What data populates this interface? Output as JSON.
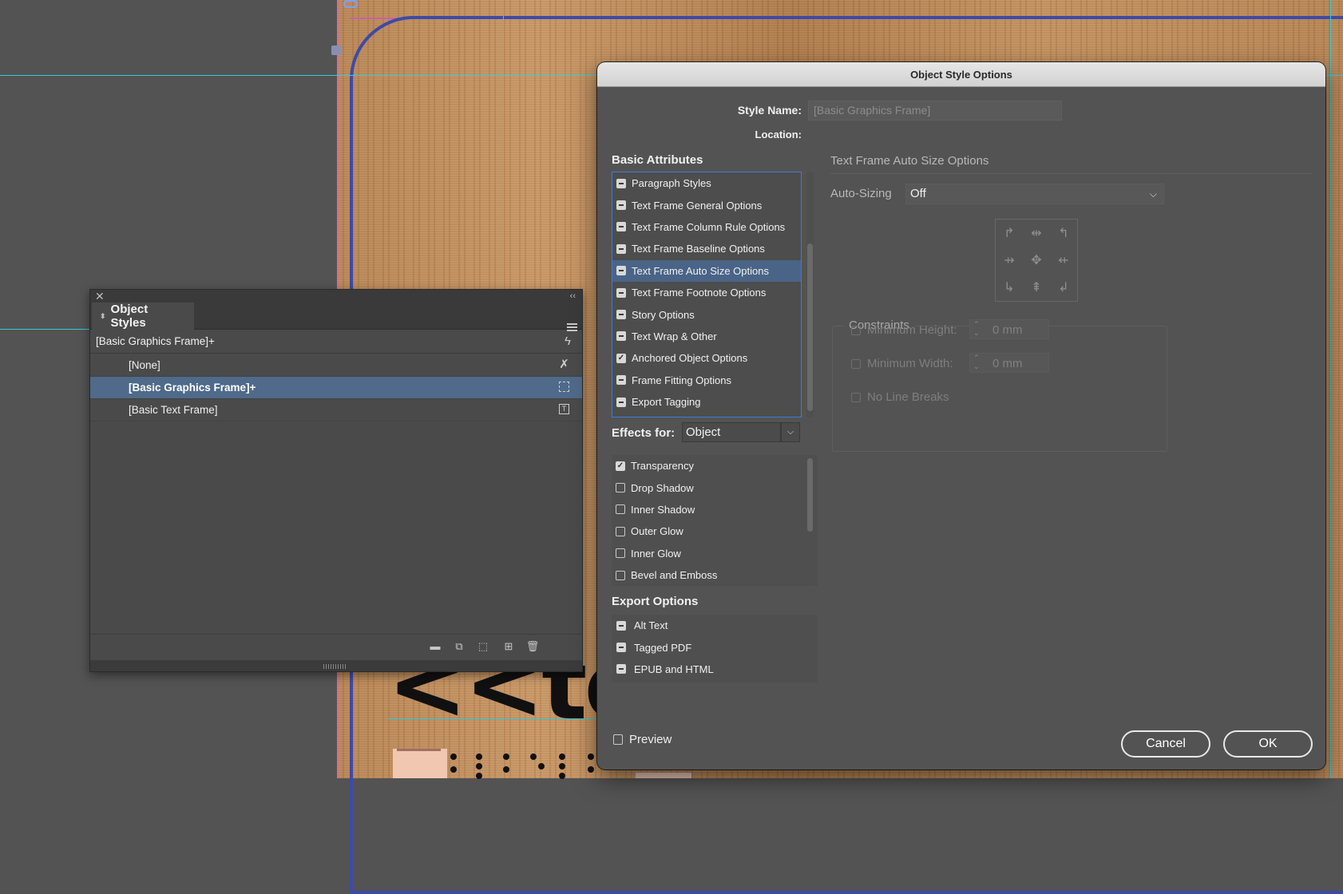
{
  "object_styles_panel": {
    "tab_label": "Object Styles",
    "current_style": "[Basic Graphics Frame]+",
    "styles": [
      {
        "label": "[None]",
        "icon": "none-style-icon"
      },
      {
        "label": "[Basic Graphics Frame]+",
        "icon": "graphics-frame-icon"
      },
      {
        "label": "[Basic Text Frame]",
        "icon": "text-frame-icon"
      }
    ],
    "footer_icons": [
      "new-group-icon",
      "clear-overrides-icon",
      "clear-attributes-icon",
      "new-style-icon",
      "delete-icon"
    ]
  },
  "dialog": {
    "title": "Object Style Options",
    "style_name_label": "Style Name:",
    "style_name_value": "[Basic Graphics Frame]",
    "location_label": "Location:",
    "basic_attributes_title": "Basic Attributes",
    "basic_attributes": [
      {
        "label": "Paragraph Styles",
        "state": "dash"
      },
      {
        "label": "Text Frame General Options",
        "state": "dash"
      },
      {
        "label": "Text Frame Column Rule Options",
        "state": "dash"
      },
      {
        "label": "Text Frame Baseline Options",
        "state": "dash"
      },
      {
        "label": "Text Frame Auto Size Options",
        "state": "dash",
        "selected": true
      },
      {
        "label": "Text Frame Footnote Options",
        "state": "dash"
      },
      {
        "label": "Story Options",
        "state": "dash"
      },
      {
        "label": "Text Wrap & Other",
        "state": "dash"
      },
      {
        "label": "Anchored Object Options",
        "state": "checked"
      },
      {
        "label": "Frame Fitting Options",
        "state": "dash"
      },
      {
        "label": "Export Tagging",
        "state": "dash"
      }
    ],
    "effects_for_label": "Effects for:",
    "effects_for_value": "Object",
    "effects": [
      {
        "label": "Transparency",
        "state": "checked"
      },
      {
        "label": "Drop Shadow",
        "state": "empty"
      },
      {
        "label": "Inner Shadow",
        "state": "empty"
      },
      {
        "label": "Outer Glow",
        "state": "empty"
      },
      {
        "label": "Inner Glow",
        "state": "empty"
      },
      {
        "label": "Bevel and Emboss",
        "state": "empty"
      }
    ],
    "export_options_title": "Export Options",
    "export_options": [
      {
        "label": "Alt Text",
        "state": "dash"
      },
      {
        "label": "Tagged PDF",
        "state": "dash"
      },
      {
        "label": "EPUB and HTML",
        "state": "dash"
      }
    ],
    "section_title": "Text Frame Auto Size Options",
    "auto_sizing_label": "Auto-Sizing",
    "auto_sizing_value": "Off",
    "reference_point_icons": [
      "arrow-top-left-icon",
      "arrow-top-center-icon",
      "arrow-top-right-icon",
      "arrow-middle-left-icon",
      "arrow-center-icon",
      "arrow-middle-right-icon",
      "arrow-bottom-left-icon",
      "arrow-bottom-center-icon",
      "arrow-bottom-right-icon"
    ],
    "constraints_title": "Constraints",
    "min_height_label": "Minimum Height:",
    "min_height_value": "0 mm",
    "min_width_label": "Minimum Width:",
    "min_width_value": "0 mm",
    "no_line_breaks_label": "No Line Breaks",
    "preview_label": "Preview",
    "cancel_label": "Cancel",
    "ok_label": "OK"
  },
  "canvas": {
    "visible_text": "<<te"
  },
  "colors": {
    "selection_blue": "#4f6a8a",
    "focus_blue": "#3f7ad6",
    "guide_cyan": "#38c9d6",
    "frame_indigo": "#3e4aa8",
    "margin_magenta": "#c65fa3"
  }
}
